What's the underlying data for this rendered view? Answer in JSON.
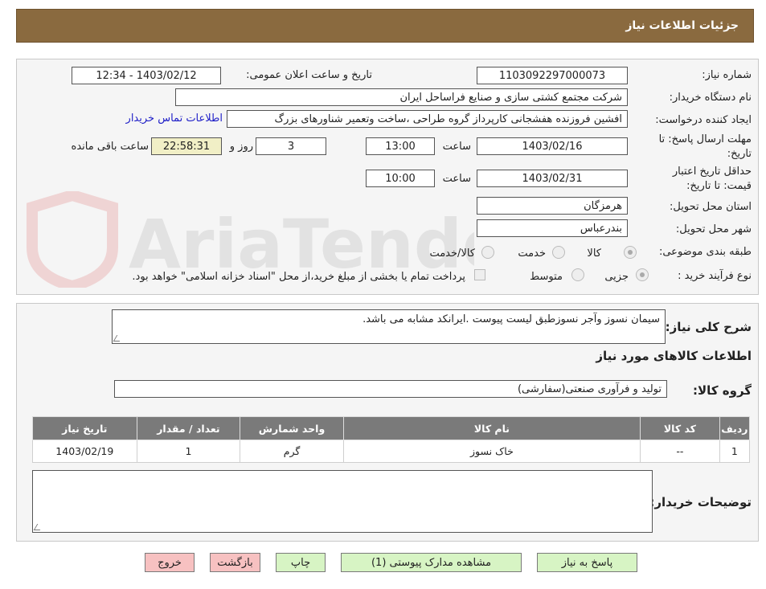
{
  "header": {
    "title": "جزئیات اطلاعات نیاز"
  },
  "form": {
    "need_number_label": "شماره نیاز:",
    "need_number": "1103092297000073",
    "announce_label": "تاریخ و ساعت اعلان عمومی:",
    "announce_value": "1403/02/12 - 12:34",
    "buyer_label": "نام دستگاه خریدار:",
    "buyer_value": "شرکت مجتمع کشتی سازی و صنایع فراساحل ایران",
    "creator_label": "ایجاد کننده درخواست:",
    "creator_value": "افشین فروزنده هفشجانی کارپرداز گروه طراحی ،ساخت وتعمیر شناورهای بزرگ",
    "contact_link": "اطلاعات تماس خریدار",
    "deadline_label_1": "مهلت ارسال پاسخ: تا",
    "deadline_label_2": "تاریخ:",
    "deadline_date": "1403/02/16",
    "time_label": "ساعت",
    "deadline_time": "13:00",
    "days_value": "3",
    "days_label": "روز و",
    "remaining_time": "22:58:31",
    "remaining_label": "ساعت باقی مانده",
    "validity_label_1": "حداقل تاریخ اعتبار",
    "validity_label_2": "قیمت: تا تاریخ:",
    "validity_date": "1403/02/31",
    "validity_time": "10:00",
    "province_label": "استان محل تحویل:",
    "province_value": "هرمزگان",
    "city_label": "شهر محل تحویل:",
    "city_value": "بندرعباس",
    "category_label": "طبقه بندی موضوعی:",
    "category_options": [
      "کالا",
      "خدمت",
      "کالا/خدمت"
    ],
    "process_label": "نوع فرآیند خرید :",
    "process_options": [
      "جزیی",
      "متوسط"
    ],
    "payment_note": "پرداخت تمام یا بخشی از مبلغ خرید،از محل \"اسناد خزانه اسلامی\" خواهد بود."
  },
  "summary": {
    "label": "شرح کلی نیاز:",
    "value": "سیمان نسوز وآجر نسوزطبق لیست پیوست .ایرانکد مشابه می باشد.",
    "items_title": "اطلاعات کالاهای مورد نیاز",
    "group_label": "گروه کالا:",
    "group_value": "تولید و فرآوری صنعتی(سفارشی)"
  },
  "table": {
    "headers": [
      "ردیف",
      "کد کالا",
      "نام کالا",
      "واحد شمارش",
      "تعداد / مقدار",
      "تاریخ نیاز"
    ],
    "rows": [
      [
        "1",
        "--",
        "خاک نسوز",
        "گرم",
        "1",
        "1403/02/19"
      ]
    ]
  },
  "notes": {
    "label": "توضیحات خریدار:"
  },
  "buttons": {
    "reply": "پاسخ به نیاز",
    "attachments": "مشاهده مدارک پیوستی (1)",
    "print": "چاپ",
    "back": "بازگشت",
    "exit": "خروج"
  },
  "colors": {
    "header_bg": "#8a6a3f",
    "button_green": "#d7f4c4",
    "button_pink": "#f7c1c1",
    "link": "#2020c8"
  },
  "watermark": {
    "text": "AriaTender.neT"
  }
}
